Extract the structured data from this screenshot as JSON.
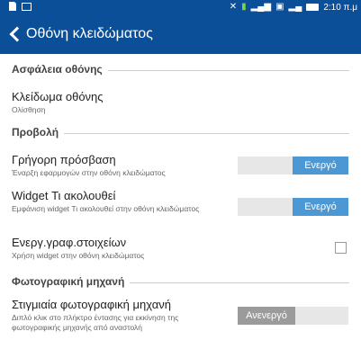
{
  "status_bar": {
    "time": "2:10 π.μ",
    "icons": [
      "document-icon",
      "image-icon",
      "mute-icon",
      "battery-saver-icon",
      "signal-icon",
      "sim-icon",
      "battery-icon"
    ]
  },
  "app_bar": {
    "title": "Οθόνη κλειδώματος"
  },
  "sections": {
    "screen_security": "Ασφάλεια οθόνης",
    "display": "Προβολή",
    "camera": "Φωτογραφική μηχανή"
  },
  "items": {
    "screen_lock": {
      "title": "Κλείδωμα οθόνης",
      "subtitle": "Ολίσθηση"
    },
    "quick_access": {
      "title": "Γρήγορη πρόσβαση",
      "subtitle": "Έναρξη εφαρμογών στην οθόνη κλειδώματος",
      "state_label": "Ενεργό",
      "enabled": true
    },
    "widget_next": {
      "title": "Widget Τι ακολουθεί",
      "subtitle": "Εμφάνιση widget Τι ακολουθεί στην οθόνη κλειδώματος",
      "state_label": "Ενεργό",
      "enabled": true
    },
    "widgets_enable": {
      "title": "Ενεργ.γραφ.στοιχείων",
      "subtitle": "Χρήση widget στην οθόνη κλειδώματος",
      "checked": false
    },
    "instant_camera": {
      "title": "Στιγμιαία φωτογραφική μηχανή",
      "subtitle": "Διπλό κλικ στο πλήκτρο έντασης για εκκίνηση της φωτογραφικής μηχανής από αναστολή",
      "state_label": "Ανενεργό",
      "enabled": false
    }
  },
  "colors": {
    "app_bar": "#0b4f98",
    "toggle_on": "#4c98d4",
    "toggle_off": "#9b9b9b"
  }
}
